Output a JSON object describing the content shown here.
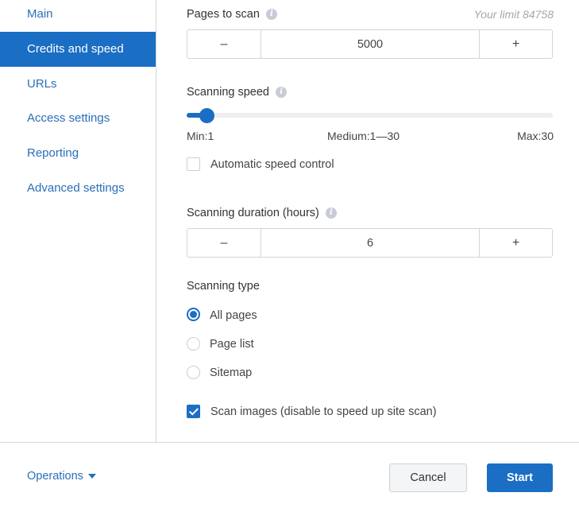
{
  "sidebar": {
    "items": [
      {
        "label": "Main",
        "active": false
      },
      {
        "label": "Credits and speed",
        "active": true
      },
      {
        "label": "URLs",
        "active": false
      },
      {
        "label": "Access settings",
        "active": false
      },
      {
        "label": "Reporting",
        "active": false
      },
      {
        "label": "Advanced settings",
        "active": false
      }
    ]
  },
  "pages_to_scan": {
    "label": "Pages to scan",
    "limit_text": "Your limit 84758",
    "minus": "–",
    "value": "5000",
    "plus": "+"
  },
  "scanning_speed": {
    "label": "Scanning speed",
    "min": 1,
    "max": 30,
    "value": 2,
    "min_label": "Min:1",
    "medium_label": "Medium:1—30",
    "max_label": "Max:30",
    "auto_control_label": "Automatic speed control",
    "auto_control_checked": false
  },
  "scanning_duration": {
    "label": "Scanning duration (hours)",
    "minus": "–",
    "value": "6",
    "plus": "+"
  },
  "scanning_type": {
    "label": "Scanning type",
    "options": [
      {
        "label": "All pages",
        "selected": true
      },
      {
        "label": "Page list",
        "selected": false
      },
      {
        "label": "Sitemap",
        "selected": false
      }
    ]
  },
  "scan_images": {
    "label": "Scan images (disable to speed up site scan)",
    "checked": true
  },
  "footer": {
    "operations_label": "Operations",
    "cancel_label": "Cancel",
    "start_label": "Start"
  },
  "colors": {
    "accent": "#1a6ec4",
    "link": "#2a6fb8"
  }
}
